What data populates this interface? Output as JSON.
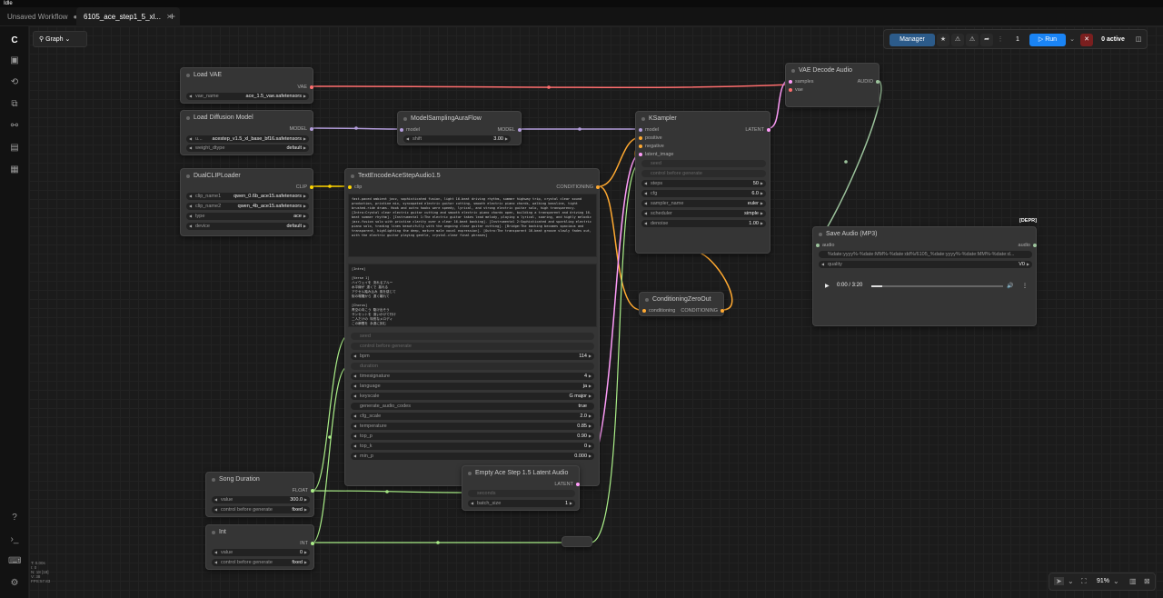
{
  "status": "Idle",
  "tabs": [
    {
      "label": "Unsaved Workflow",
      "mark": "●"
    },
    {
      "label": "6105_ace_step1_5_xl...",
      "mark": "✕"
    }
  ],
  "toolbar": {
    "graph_label": "Graph",
    "manager_label": "Manager",
    "queue_count": "1",
    "run_label": "Run",
    "active_label": "0 active"
  },
  "nodes": {
    "load_vae": {
      "title": "Load VAE",
      "out": "VAE",
      "w_vae_name": "vae_name",
      "v_vae_name": "ace_1.5_vae.safetensors"
    },
    "load_diffusion": {
      "title": "Load Diffusion Model",
      "out": "MODEL",
      "w_unet": "u...",
      "v_unet": "acestep_v1.5_xl_base_bf16.safetensors",
      "w_dtype": "weight_dtype",
      "v_dtype": "default"
    },
    "dual_clip": {
      "title": "DualCLIPLoader",
      "out": "CLIP",
      "rows": [
        {
          "l": "clip_name1",
          "v": "qwen_0.6b_ace15.safetensors"
        },
        {
          "l": "clip_name2",
          "v": "qwen_4b_ace15.safetensors"
        },
        {
          "l": "type",
          "v": "ace"
        },
        {
          "l": "device",
          "v": "default"
        }
      ]
    },
    "msaf": {
      "title": "ModelSamplingAuraFlow",
      "in": "model",
      "out": "MODEL",
      "w_shift": "shift",
      "v_shift": "3.00"
    },
    "text_encode": {
      "title": "TextEncodeAceStepAudio1.5",
      "in": "clip",
      "out": "CONDITIONING",
      "tags": "fast-paced ambient jazz, sophisticated fusion, light 16-beat driving rhythm, summer highway trip, crystal clear sound production, pristine mix, syncopated electric guitar cutting, smooth electric piano chords, walking bassline, tight brushed-ride drums. Hook and outro hooks were speedy, lyrical, and strong electric guitar solo, high transparency. [Intro:Crystal clear electric guitar cutting and smooth electric piano chords open, building a transparent and driving 16-beat summer rhythm]. [Instrumental 1:The electric guitar takes lead melody, playing a lyrical, soaring, and highly melodic jazz-fusion solo with pristine clarity over a clear 16-beat backing]. [Instrumental 2:Sophisticated and sparkling electric piano solo, trading lines beautifully with the ongoing clear guitar cutting]. [Bridge:The backing becomes spacious and transparent, highlighting the deep, mature male vocal expression]. [Outro:The transparent 16-beat groove slowly fades out, with the electric guitar playing gentle, crystal-clear final phrases]",
      "lyrics": "[Intro]\n\n[Verse 1]\nハイウェイを 流れるブルー\n水平線が 遠くで 揺れる\nアクセル踏み込み 風を感じて\n街の喧騒から 遠く離れて\n\n[Chorus]\n青空の向こう 駆け出そう\nサンセットを 追いかけて行け\n二人だけの 特別なメロディ\nこの瞬間を 永遠に刻む",
      "seed_label": "seed",
      "cbg_label": "control before generate",
      "rows": [
        {
          "l": "bpm",
          "v": "114"
        },
        {
          "l": "duration",
          "v": ""
        },
        {
          "l": "timesignature",
          "v": "4"
        },
        {
          "l": "language",
          "v": "ja"
        },
        {
          "l": "keyscale",
          "v": "G major"
        },
        {
          "l": "generate_audio_codes",
          "v": "true"
        },
        {
          "l": "cfg_scale",
          "v": "2.0"
        },
        {
          "l": "temperature",
          "v": "0.85"
        },
        {
          "l": "top_p",
          "v": "0.90"
        },
        {
          "l": "top_k",
          "v": "0"
        },
        {
          "l": "min_p",
          "v": "0.000"
        }
      ]
    },
    "ksampler": {
      "title": "KSampler",
      "ins": [
        "model",
        "positive",
        "negative",
        "latent_image",
        "seed"
      ],
      "out": "LATENT",
      "cbg": "control before generate",
      "rows": [
        {
          "l": "steps",
          "v": "50"
        },
        {
          "l": "cfg",
          "v": "6.0"
        },
        {
          "l": "sampler_name",
          "v": "euler"
        },
        {
          "l": "scheduler",
          "v": "simple"
        },
        {
          "l": "denoise",
          "v": "1.00"
        }
      ]
    },
    "vae_decode": {
      "title": "VAE Decode Audio",
      "ins": [
        "samples",
        "vae"
      ],
      "out": "AUDIO"
    },
    "save_audio": {
      "title": "Save Audio (MP3)",
      "badge": "[DEPR]",
      "in": "audio",
      "out": "audio",
      "filename": "%date:yyyy%-%date:MM%-%date:dd%/6105_%date:yyyy%-%date:MM%-%date:d...",
      "w_quality": "quality",
      "v_quality": "V0",
      "time": "0:00 / 3:20"
    },
    "cond_zero": {
      "title": "ConditioningZeroOut",
      "in": "conditioning",
      "out": "CONDITIONING"
    },
    "empty_latent": {
      "title": "Empty Ace Step 1.5 Latent Audio",
      "in": "seconds",
      "out": "LATENT",
      "w_batch": "batch_size",
      "v_batch": "1"
    },
    "song_duration": {
      "title": "Song Duration",
      "out": "FLOAT",
      "w_value": "value",
      "v_value": "300.0",
      "w_cbg": "control before generate",
      "v_cbg": "fixed"
    },
    "int_node": {
      "title": "Int",
      "out": "INT",
      "w_value": "value",
      "v_value": "0",
      "w_cbg": "control before generate",
      "v_cbg": "fixed"
    }
  },
  "bottom": {
    "zoom": "91%",
    "fps": "T: 0.00s\nI: 0\nN: 18 [18]\nV: 38\nFPS:57.83"
  },
  "colors": {
    "vae": "#ff6e6e",
    "model": "#b39ddb",
    "clip": "#ffd500",
    "cond": "#ffa931",
    "latent": "#ff9cf9",
    "audio": "#9cc39c",
    "float": "#aaee88",
    "int": "#aaee88",
    "accent": "#1a84f5"
  }
}
